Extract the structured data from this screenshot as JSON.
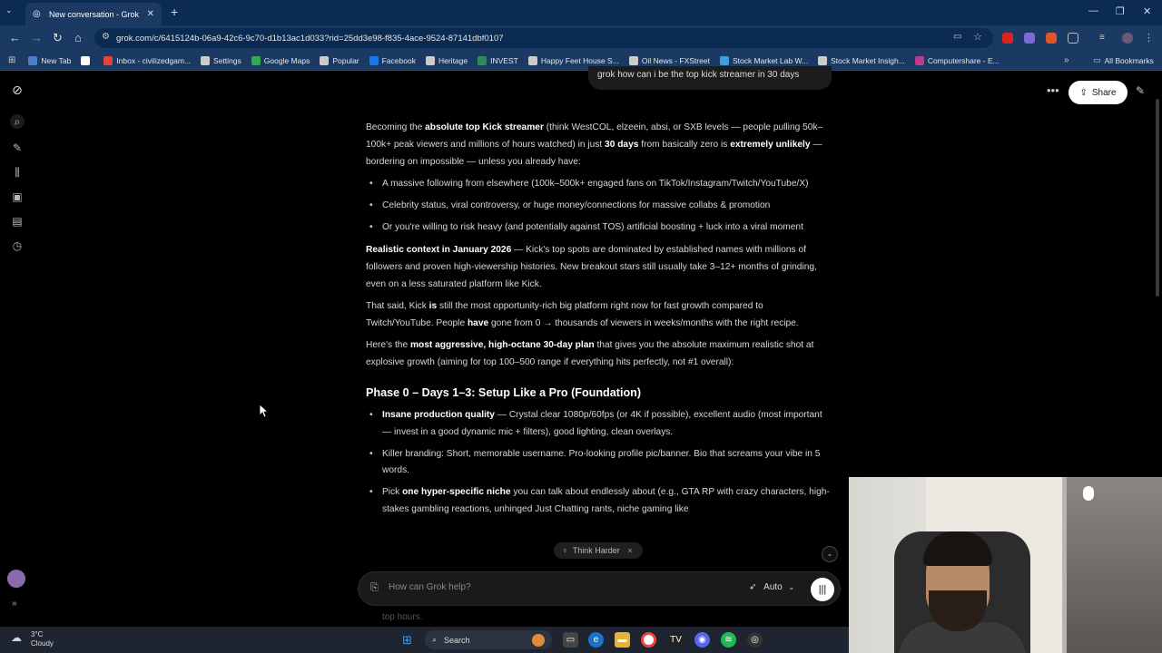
{
  "browser": {
    "tab_title": "New conversation - Grok",
    "url": "grok.com/c/6415124b-06a9-42c6-9c70-d1b13ac1d033?rid=25dd3e98-f835-4ace-9524-87141dbf0107",
    "bookmarks": [
      {
        "label": "New Tab",
        "icon": "grid-icon",
        "color": "#4d7cc9"
      },
      {
        "label": "",
        "icon": "github-icon",
        "color": "#ffffff"
      },
      {
        "label": "Inbox - civilizedgam...",
        "icon": "mail-icon",
        "color": "#ea4335"
      },
      {
        "label": "Settings",
        "icon": "gear-icon",
        "color": "#cccccc"
      },
      {
        "label": "Google Maps",
        "icon": "map-pin-icon",
        "color": "#34a853"
      },
      {
        "label": "Popular",
        "icon": "folder-icon",
        "color": "#cccccc"
      },
      {
        "label": "Facebook",
        "icon": "facebook-icon",
        "color": "#1877f2"
      },
      {
        "label": "Heritage",
        "icon": "globe-icon",
        "color": "#cccccc"
      },
      {
        "label": "INVEST",
        "icon": "invest-icon",
        "color": "#2e8b57"
      },
      {
        "label": "Happy Feet House S...",
        "icon": "globe-icon",
        "color": "#cccccc"
      },
      {
        "label": "Oil News - FXStreet",
        "icon": "globe-icon",
        "color": "#cccccc"
      },
      {
        "label": "Stock Market Lab W...",
        "icon": "snowflake-icon",
        "color": "#3aa0e0"
      },
      {
        "label": "Stock Market Insigh...",
        "icon": "globe-icon",
        "color": "#cccccc"
      },
      {
        "label": "Computershare - E...",
        "icon": "computershare-icon",
        "color": "#c03a8a"
      }
    ],
    "all_bookmarks": "All Bookmarks"
  },
  "grok": {
    "user_message": "grok how can i be the top kick streamer in 30 days",
    "share_label": "Share",
    "think_harder": "Think Harder",
    "input_placeholder": "How can Grok help?",
    "mode_label": "Auto",
    "trailing_text": "top hours."
  },
  "response": {
    "intro": {
      "t1": "Becoming the ",
      "b1": "absolute top Kick streamer",
      "t2": " (think WestCOL, elzeein, absi, or SXB levels — people pulling 50k–100k+ peak viewers and millions of hours watched) in just ",
      "b2": "30 days",
      "t3": " from basically zero is ",
      "b3": "extremely unlikely",
      "t4": " — bordering on impossible — unless you already have:"
    },
    "bullets1": [
      "A massive following from elsewhere (100k–500k+ engaged fans on TikTok/Instagram/Twitch/YouTube/X)",
      "Celebrity status, viral controversy, or huge money/connections for massive collabs & promotion",
      "Or you're willing to risk heavy (and potentially against TOS) artificial boosting + luck into a viral moment"
    ],
    "context": {
      "b1": "Realistic context in January 2026",
      "t1": " — Kick's top spots are dominated by established names with millions of followers and proven high-viewership histories. New breakout stars still usually take 3–12+ months of grinding, even on a less saturated platform like Kick."
    },
    "that_said": {
      "t1": "That said, Kick ",
      "b1": "is",
      "t2": " still the most opportunity-rich big platform right now for fast growth compared to Twitch/YouTube. People ",
      "b2": "have",
      "t3": " gone from 0 → thousands of viewers in weeks/months with the right recipe."
    },
    "plan": {
      "t1": "Here's the ",
      "b1": "most aggressive, high-octane 30-day plan",
      "t2": " that gives you the absolute maximum realistic shot at explosive growth (aiming for top 100–500 range if everything hits perfectly, not #1 overall):"
    },
    "phase0_heading": "Phase 0 – Days 1–3: Setup Like a Pro (Foundation)",
    "phase0": {
      "i1_b": "Insane production quality",
      "i1_t": " — Crystal clear 1080p/60fps (or 4K if possible), excellent audio (most important — invest in a good dynamic mic + filters), good lighting, clean overlays.",
      "i2": "Killer branding: Short, memorable username. Pro-looking profile pic/banner. Bio that screams your vibe in 5 words.",
      "i3_t1": "Pick ",
      "i3_b": "one hyper-specific niche",
      "i3_t2": " you can talk about endlessly about (e.g., GTA RP with crazy characters, high-stakes gambling reactions, unhinged Just Chatting rants, niche gaming like"
    }
  },
  "taskbar": {
    "temperature": "3°C",
    "condition": "Cloudy",
    "search_label": "Search"
  },
  "colors": {
    "chrome_frame": "#0b2b52",
    "chrome_toolbar": "#1a3a63",
    "app_background": "#000000",
    "taskbar": "#1e2530"
  }
}
